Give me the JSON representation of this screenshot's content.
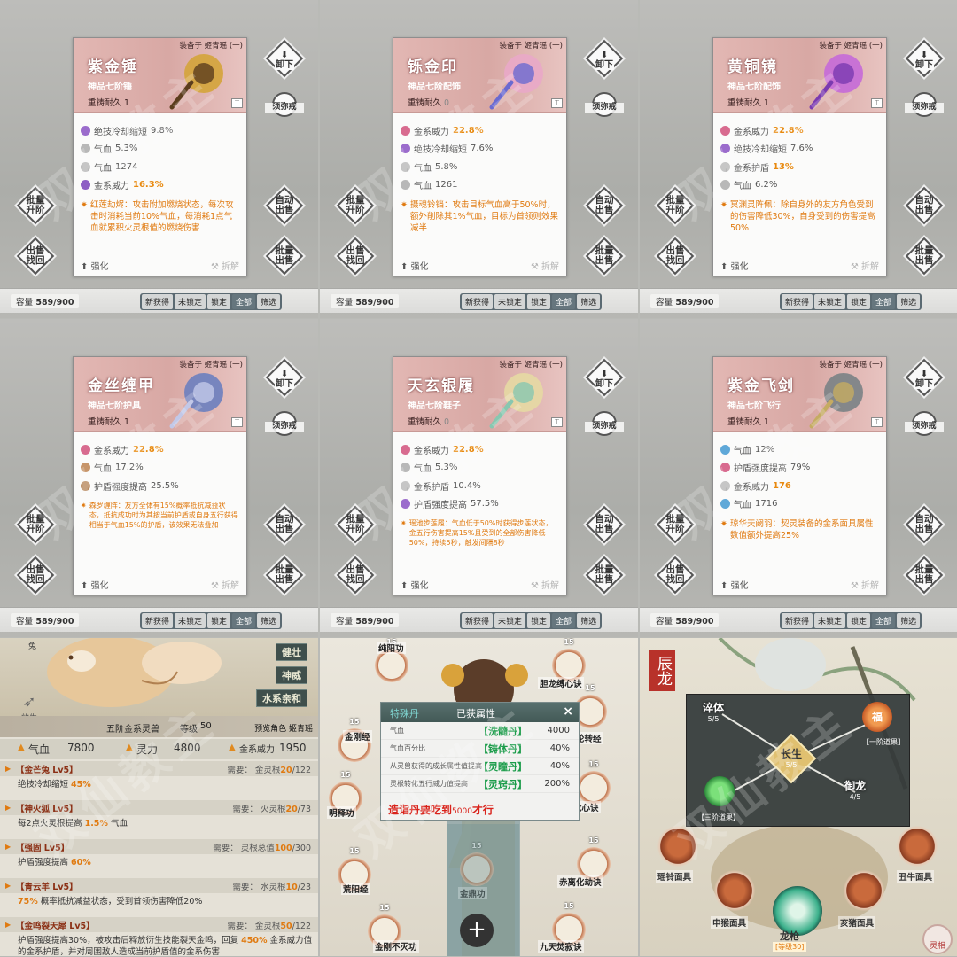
{
  "watermark": "双仙教主",
  "cards": [
    {
      "equipped": "装备于 姬青瑶 (一)",
      "name": "紫金锤",
      "grade": "神品七阶锤",
      "reforge_label": "重铸耐久",
      "reforge_val": "1",
      "attrs": [
        {
          "icon": "purple-flame",
          "label": "绝技冷却缩短",
          "val": "9.8%",
          "hi": false
        },
        {
          "icon": "grey-drop",
          "label": "气血",
          "val": "5.3%",
          "hi": false
        },
        {
          "icon": "grey-drop",
          "label": "气血",
          "val": "1274",
          "hi": false
        },
        {
          "icon": "purple-gem",
          "label": "金系威力",
          "val": "16.3%",
          "hi": true
        }
      ],
      "special": "红莲劫烬：攻击附加燃烧状态，每次攻击时消耗当前10%气血，每消耗1点气血就累积火灵根值的燃烧伤害",
      "small": false
    },
    {
      "equipped": "装备于 姬青瑶 (一)",
      "name": "铄金印",
      "grade": "神品七阶配饰",
      "reforge_label": "重铸耐久",
      "reforge_val": "0",
      "attrs": [
        {
          "icon": "pink-gem",
          "label": "金系威力",
          "val": "22.8%",
          "hi": true
        },
        {
          "icon": "purple-flame",
          "label": "绝技冷却缩短",
          "val": "7.6%",
          "hi": false
        },
        {
          "icon": "grey-drop",
          "label": "气血",
          "val": "5.8%",
          "hi": false
        },
        {
          "icon": "grey-drop",
          "label": "气血",
          "val": "1261",
          "hi": false
        }
      ],
      "special": "摄魂铃铛：攻击目标气血高于50%时，额外削除其1%气血，目标为首领则效果减半",
      "small": false
    },
    {
      "equipped": "装备于 姬青瑶 (一)",
      "name": "黄铜镜",
      "grade": "神品七阶配饰",
      "reforge_label": "重铸耐久",
      "reforge_val": "1",
      "attrs": [
        {
          "icon": "pink-gem",
          "label": "金系威力",
          "val": "22.8%",
          "hi": true
        },
        {
          "icon": "purple-flame",
          "label": "绝技冷却缩短",
          "val": "7.6%",
          "hi": false
        },
        {
          "icon": "grey-drop",
          "label": "金系护盾",
          "val": "13%",
          "hi": true
        },
        {
          "icon": "grey-drop",
          "label": "气血",
          "val": "6.2%",
          "hi": false
        }
      ],
      "special": "冥渊灵阵佩：除自身外的友方角色受到的伤害降低30%，自身受到的伤害提高50%",
      "small": false
    },
    {
      "equipped": "装备于 姬青瑶 (一)",
      "name": "金丝缠甲",
      "grade": "神品七阶护具",
      "reforge_label": "重铸耐久",
      "reforge_val": "1",
      "attrs": [
        {
          "icon": "pink-gem",
          "label": "金系威力",
          "val": "22.8%",
          "hi": true
        },
        {
          "icon": "bronze-drop",
          "label": "气血",
          "val": "17.2%",
          "hi": false
        },
        {
          "icon": "bronze-shield",
          "label": "护盾强度提高",
          "val": "25.5%",
          "hi": false
        }
      ],
      "special": "森罗缠阵：友方全体有15%概率抵抗减益状态，抵抗成功时为其按当前护盾或自身五行获得相当于气血15%的护盾，该效果无法叠加",
      "small": true
    },
    {
      "equipped": "装备于 姬青瑶 (一)",
      "name": "天玄银履",
      "grade": "神品七阶鞋子",
      "reforge_label": "重铸耐久",
      "reforge_val": "0",
      "attrs": [
        {
          "icon": "pink-gem",
          "label": "金系威力",
          "val": "22.8%",
          "hi": true
        },
        {
          "icon": "grey-drop",
          "label": "气血",
          "val": "5.3%",
          "hi": false
        },
        {
          "icon": "grey-drop",
          "label": "金系护盾",
          "val": "10.4%",
          "hi": false
        },
        {
          "icon": "purple-flame",
          "label": "护盾强度提高",
          "val": "57.5%",
          "hi": false
        }
      ],
      "special": "瑶池步莲履：气血低于50%时获得步莲状态，金五行伤害提高15%且受到的全部伤害降低50%，持续5秒，触发间隔8秒",
      "small": true
    },
    {
      "equipped": "装备于 姬青瑶 (一)",
      "name": "紫金飞剑",
      "grade": "神品七阶飞行",
      "reforge_label": "重铸耐久",
      "reforge_val": "1",
      "attrs": [
        {
          "icon": "blue-drop",
          "label": "气血",
          "val": "12%",
          "hi": false
        },
        {
          "icon": "pink-gem",
          "label": "护盾强度提高",
          "val": "79%",
          "hi": false
        },
        {
          "icon": "grey-drop",
          "label": "金系威力",
          "val": "176",
          "hi": true
        },
        {
          "icon": "blue-drop",
          "label": "气血",
          "val": "1716",
          "hi": false
        }
      ],
      "special": "琼华天阙羽：契灵装备的金系面具属性数值额外提高25%",
      "small": false
    }
  ],
  "buttons": {
    "unequip": "卸下",
    "ring": "须弥戒",
    "batch_upgrade": "批量升阶",
    "auto_sell": "自动出售",
    "sell_retrieve": "出售找回",
    "batch_sell": "批量出售",
    "strengthen": "强化",
    "dismantle": "拆解"
  },
  "bar": {
    "capacity_label": "容量",
    "capacity": "589/900",
    "tabs": [
      "新获得",
      "未锁定",
      "锁定",
      "全部",
      "筛选"
    ]
  },
  "pet": {
    "tags": [
      "健壮",
      "神威",
      "水系亲和"
    ],
    "corner": "兔",
    "release": "放生",
    "title": "五阶金系灵兽",
    "level_label": "等级",
    "level": "50",
    "preview": "预览角色 姬青瑶",
    "stats": [
      {
        "label": "气血",
        "val": "7800"
      },
      {
        "label": "灵力",
        "val": "4800"
      },
      {
        "label": "金系威力",
        "val": "1950"
      }
    ],
    "skills": [
      {
        "name": "【金芒兔 Lv5】",
        "need_label": "需要：",
        "need": "金灵根",
        "cur": "20",
        "max": "/122",
        "pre": "绝技冷却缩短 ",
        "hl": "45%",
        "post": ""
      },
      {
        "name": "【神火狐 Lv5】",
        "need_label": "需要：",
        "need": "火灵根",
        "cur": "20",
        "max": "/73",
        "pre": "每2点火灵根提高 ",
        "hl": "1.5%",
        "post": " 气血"
      },
      {
        "name": "【强固 Lv5】",
        "need_label": "需要：",
        "need": "灵根总值",
        "cur": "100",
        "max": "/300",
        "pre": "护盾强度提高 ",
        "hl": "60%",
        "post": ""
      },
      {
        "name": "【青云羊 Lv5】",
        "need_label": "需要：",
        "need": "水灵根",
        "cur": "10",
        "max": "/23",
        "pre": "",
        "hl": "75%",
        "post": " 概率抵抗减益状态，受到首领伤害降低20%"
      },
      {
        "name": "【金鸣裂天犀 Lv5】",
        "need_label": "需要：",
        "need": "金灵根",
        "cur": "50",
        "max": "/122",
        "pre": "护盾强度提高30%，被攻击后释放衍生技能裂天金鸣，回复 ",
        "hl": "450%",
        "post": " 金系威力值的金系护盾，并对周围敌人造成当前护盾值的金系伤害"
      }
    ]
  },
  "dan": {
    "tab": "特殊丹",
    "title": "已获属性",
    "close": "×",
    "rows": [
      {
        "label": "气血",
        "dan": "【洗髓丹】",
        "val": "4000"
      },
      {
        "label": "气血百分比",
        "dan": "【铸体丹】",
        "val": "40%"
      },
      {
        "label": "从灵兽获得的成长属性值提高",
        "dan": "【灵瞳丹】",
        "val": "40%"
      },
      {
        "label": "灵根转化五行威力值提高",
        "dan": "【灵窍丹】",
        "val": "200%"
      }
    ],
    "warn_a": "造诣丹要吃到",
    "warn_num": "5000",
    "warn_b": "才行",
    "nodes": [
      {
        "name": "纯阳功",
        "n": "15"
      },
      {
        "name": "金刚经",
        "n": "15"
      },
      {
        "name": "明释功",
        "n": "15"
      },
      {
        "name": "荒阳经",
        "n": "15"
      },
      {
        "name": "金刚不灭功",
        "n": "15"
      },
      {
        "name": "金鼎功",
        "n": "15"
      },
      {
        "name": "胆龙缚心诀",
        "n": "15"
      },
      {
        "name": "赤霄轮转经",
        "n": "15"
      },
      {
        "name": "龙心诀",
        "n": "15"
      },
      {
        "name": "赤离化劫诀",
        "n": "15"
      },
      {
        "name": "九天焚寂诀",
        "n": "15"
      }
    ],
    "plus": "+"
  },
  "dragon": {
    "title": "辰龙",
    "nodes": [
      {
        "name": "淬体",
        "lv": "5/5"
      },
      {
        "name": "长生",
        "lv": "5/5"
      },
      {
        "name": "御龙",
        "lv": "4/5"
      }
    ],
    "tier1_icon": "福",
    "tier1": "【一阶道果】",
    "tier3": "【三阶道果】",
    "masks": [
      "瑶铃面具",
      "丑牛面具",
      "申猴面具",
      "亥猪面具"
    ],
    "center": "龙枪",
    "center_sub": "[等级30]",
    "corner": "灵相"
  }
}
